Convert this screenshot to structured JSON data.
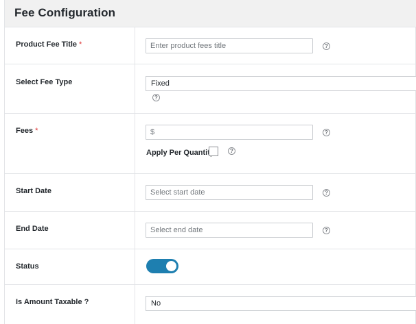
{
  "header": {
    "title": "Fee Configuration"
  },
  "rows": {
    "product_fee_title": {
      "label": "Product Fee Title",
      "required_mark": "*",
      "placeholder": "Enter product fees title",
      "help": "?"
    },
    "select_fee_type": {
      "label": "Select Fee Type",
      "selected": "Fixed",
      "help": "?"
    },
    "fees": {
      "label": "Fees",
      "required_mark": "*",
      "value": "$",
      "help": "?",
      "apply_per_quantity_label": "Apply Per Quantity",
      "apply_per_quantity_checked": false,
      "apply_help": "?"
    },
    "start_date": {
      "label": "Start Date",
      "placeholder": "Select start date",
      "help": "?"
    },
    "end_date": {
      "label": "End Date",
      "placeholder": "Select end date",
      "help": "?"
    },
    "status": {
      "label": "Status",
      "enabled": true,
      "toggle_color": "#1e7fb0"
    },
    "is_amount_taxable": {
      "label": "Is Amount Taxable ?",
      "selected": "No"
    }
  }
}
